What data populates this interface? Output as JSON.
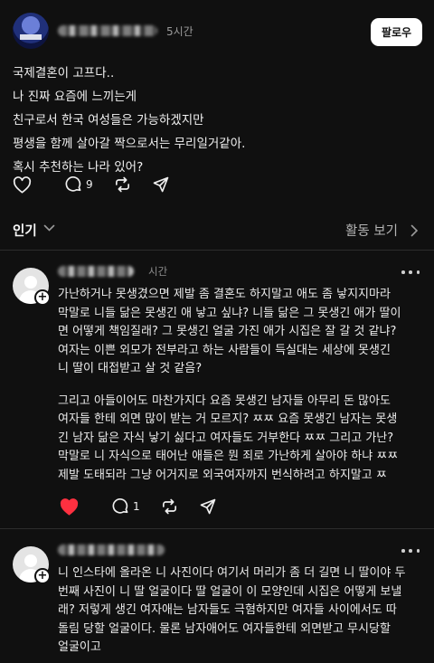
{
  "post": {
    "time": "5시간",
    "follow_label": "팔로우",
    "lines": [
      "국제결혼이 고프다..",
      "나 진짜 요즘에 느끼는게",
      "친구로서 한국 여성들은 가능하겠지만",
      "평생을 함께 살아갈 짝으로서는 무리일거같아.",
      "혹시 추천하는 나라 있어?"
    ],
    "actions": {
      "like_icon": "heart-outline-icon",
      "comment_icon": "comment-bubble-icon",
      "comment_count": "9",
      "repost_icon": "repost-icon",
      "share_icon": "send-icon"
    }
  },
  "sort": {
    "label": "인기",
    "activity_label": "활동 보기"
  },
  "comments": [
    {
      "time": "시간",
      "paragraphs": [
        [
          "가난하거나 못생겼으면 제발 좀 결혼도 하지말고 애도 좀 낳지지마라",
          "막말로 니들 닮은 못생긴 애 낳고 싶냐? 니들 닮은 그 못생긴 애가 딸이",
          "면 어떻게 책임질래? 그 못생긴 얼굴 가진 애가 시집은 잘 갈 것 같냐?",
          "여자는 이쁜 외모가 전부라고 하는 사람들이 득실대는 세상에 못생긴",
          "니 딸이 대접받고 살 것 같음?"
        ],
        [
          "그리고 아들이어도 마찬가지다 요즘 못생긴 남자들 아무리 돈 많아도",
          "여자들 한테 외면 많이 받는 거 모르지? ㅉㅉ 요즘 못생긴 남자는 못생",
          "긴 남자 닮은 자식 낳기 싫다고 여자들도 거부한다 ㅉㅉ 그리고 가난?",
          "막말로 니 자식으로 태어난 애들은 뭔 죄로 가난하게 살아야 하냐 ㅉㅉ",
          "제발 도태되라 그냥 어거지로 외국여자까지 번식하려고 하지말고 ㅉ"
        ]
      ],
      "actions": {
        "like_icon": "heart-filled-icon",
        "comment_icon": "comment-bubble-icon",
        "comment_count": "1",
        "repost_icon": "repost-icon",
        "share_icon": "send-icon"
      },
      "like_color": "#ff3040"
    },
    {
      "time": "",
      "paragraphs": [
        [
          "니 인스타에 올라온 니 사진이다 여기서 머리가 좀 더 길면 니 딸이야 두",
          "번째 사진이 니 딸 얼굴이다 딸 얼굴이 이 모양인데 시집은 어떻게 보낼",
          "래? 저렇게 생긴 여자애는 남자들도 극혐하지만 여자들 사이에서도 따",
          "돌림 당할 얼굴이다. 물론 남자애어도 여자들한테 외면받고 무시당할",
          "얼굴이고"
        ]
      ]
    }
  ]
}
